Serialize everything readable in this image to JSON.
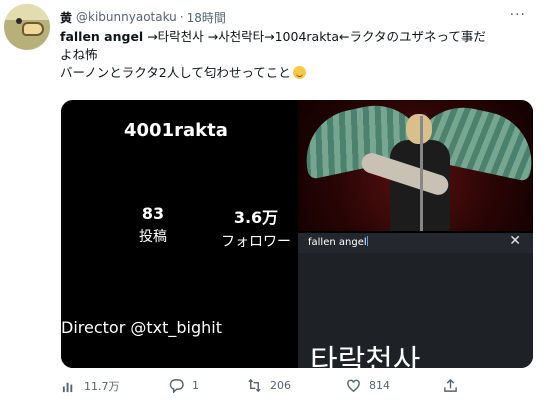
{
  "header": {
    "display_name": "黄",
    "handle": "@kibunnyaotaku",
    "separator": "·",
    "time": "18時間",
    "more_icon": "more-dots-icon"
  },
  "tweet": {
    "line1_bold": "fallen angel",
    "line1_rest": " →타락천사 →사천락타→1004rakta←ラクタのユザネって事だ",
    "line2": "よね怖",
    "line3": "バーノンとラクタ2人して匂わせってこと",
    "emoji": "sweat-smile-emoji"
  },
  "media": {
    "profile": {
      "username": "4001rakta",
      "posts_count": "83",
      "posts_label": "投稿",
      "followers_count": "3.6万",
      "followers_label": "フォロワー",
      "bio": "Director @txt_bighit"
    },
    "search": {
      "query": "fallen angel",
      "close_icon": "close-icon",
      "result_text": "타락천사"
    }
  },
  "actions": {
    "views": "11.7万",
    "replies": "1",
    "retweets": "206",
    "likes": "814"
  }
}
